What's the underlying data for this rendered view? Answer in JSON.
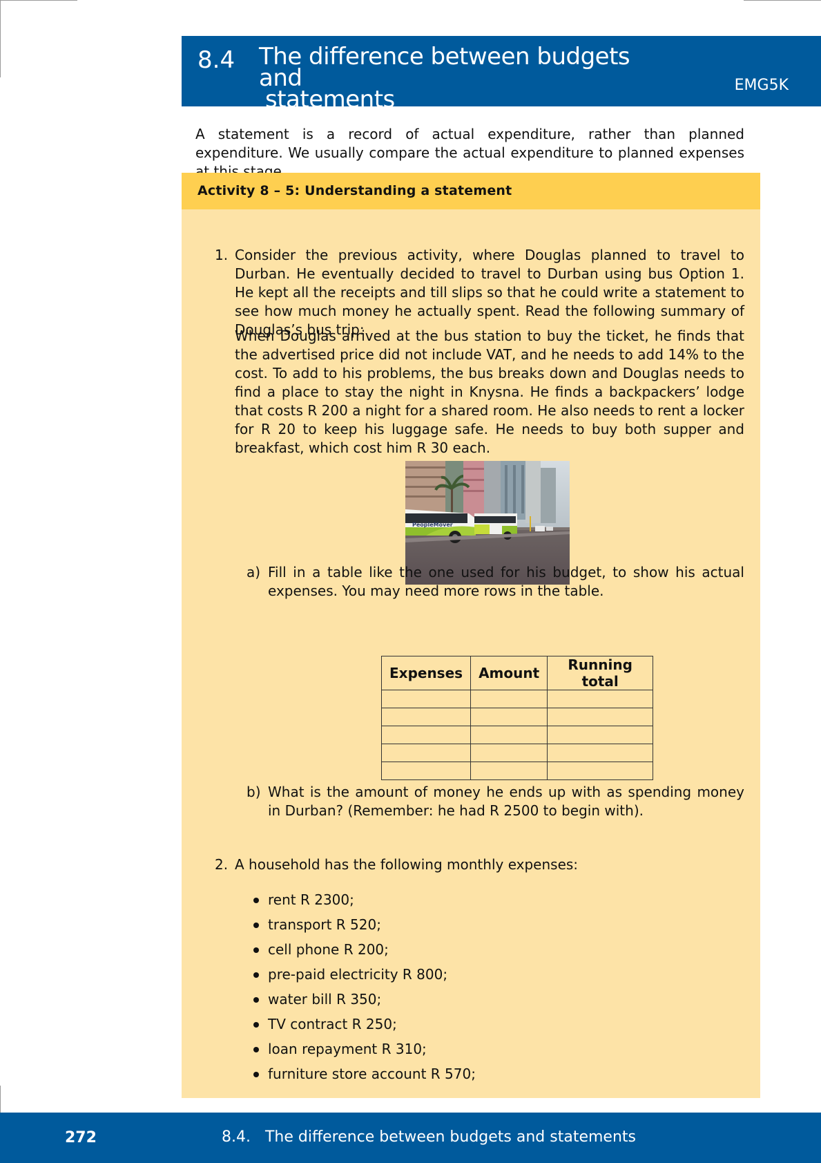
{
  "section": {
    "number": "8.4",
    "title_line1": "The difference between budgets and",
    "title_line2": "statements",
    "code": "EMG5K"
  },
  "intro": "A statement is a record of actual expenditure, rather than planned expenditure. We usually compare the actual expenditure to planned expenses at this stage.",
  "activity": {
    "title": "Activity 8 – 5: Understanding a statement",
    "q1": {
      "marker": "1.",
      "text": "Consider the previous activity, where Douglas planned to travel to Durban. He eventually decided to travel to Durban using bus Option 1. He kept all the receipts and till slips so that he could write a statement to see how much money he actually spent. Read the following summary of Douglas’s bus trip:",
      "summary": "When Douglas arrived at the bus station to buy the ticket, he finds that the advertised price did not include VAT, and he needs to add 14% to the cost. To add to his problems, the bus breaks down and Douglas needs to find a place to stay the night in Knysna. He finds a backpackers’ lodge that costs R 200 a night for a shared room. He also needs to rent a locker for R 20 to keep his luggage safe. He needs to buy both supper and breakfast, which cost him R 30 each.",
      "photo": {
        "bus_text": "PeopleMover"
      },
      "a": {
        "marker": "a)",
        "text": "Fill in a table like the one used for his budget, to show his actual expenses. You may need more rows in the table."
      },
      "table": {
        "headers": [
          "Expenses",
          "Amount",
          "Running total"
        ]
      },
      "b": {
        "marker": "b)",
        "text": "What is the amount of money he ends up with as spending money in Durban? (Remember: he had R 2500 to begin with)."
      }
    },
    "q2": {
      "marker": "2.",
      "text": "A household has the following monthly expenses:",
      "items": [
        "rent R 2300;",
        "transport R 520;",
        "cell phone R 200;",
        "pre-paid electricity R 800;",
        "water bill R 350;",
        "TV contract R 250;",
        "loan repayment R 310;",
        "furniture store account R 570;"
      ]
    }
  },
  "footer": {
    "page_number": "272",
    "title": "8.4.   The difference between budgets and statements"
  }
}
